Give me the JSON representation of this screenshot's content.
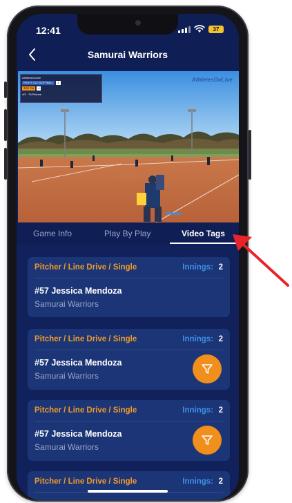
{
  "status_bar": {
    "time": "12:41",
    "battery": "37"
  },
  "nav": {
    "title": "Samurai Warriors"
  },
  "video": {
    "logo_text": "AthletesGoLive",
    "overlay_team1": "RIGHT OLD SOFTBALL",
    "overlay_team2": "TOP 7W",
    "overlay_score1": "1",
    "overlay_score2": "4",
    "overlay_meta": "4/3 · 78 Pitches"
  },
  "tabs": [
    {
      "label": "Game Info",
      "active": false
    },
    {
      "label": "Play By Play",
      "active": false
    },
    {
      "label": "Video Tags",
      "active": true
    }
  ],
  "innings_label": "Innings:",
  "cards": [
    {
      "title": "Pitcher / Line Drive / Single",
      "innings": "2",
      "player": "#57 Jessica Mendoza",
      "team": "Samurai Warriors",
      "has_filter": false
    },
    {
      "title": "Pitcher / Line Drive / Single",
      "innings": "2",
      "player": "#57 Jessica Mendoza",
      "team": "Samurai Warriors",
      "has_filter": true
    },
    {
      "title": "Pitcher / Line Drive / Single",
      "innings": "2",
      "player": "#57 Jessica Mendoza",
      "team": "Samurai Warriors",
      "has_filter": true
    },
    {
      "title": "Pitcher / Line Drive / Single",
      "innings": "2",
      "player": "",
      "team": "",
      "has_filter": false
    }
  ],
  "colors": {
    "background": "#0f1f56",
    "card": "#1c3577",
    "accent_orange": "#f08f1c",
    "innings_blue": "#3c8fe6",
    "annotation_arrow": "#e8232a"
  },
  "icons": {
    "back": "chevron-left-icon",
    "filter": "filter-funnel-icon",
    "signal": "signal-bars-icon",
    "wifi": "wifi-icon",
    "battery": "battery-icon"
  }
}
